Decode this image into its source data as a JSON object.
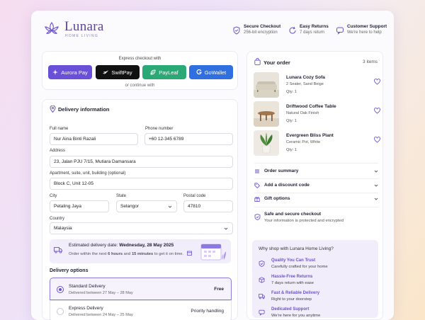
{
  "brand": {
    "name": "Lunara",
    "tagline": "HOME LIVING"
  },
  "header_features": [
    {
      "icon": "shield-icon",
      "title": "Secure Checkout",
      "subtitle": "256-bit encryption"
    },
    {
      "icon": "refresh-icon",
      "title": "Easy Returns",
      "subtitle": "7 days return"
    },
    {
      "icon": "chat-icon",
      "title": "Customer Support",
      "subtitle": "We're here to help"
    }
  ],
  "express": {
    "title": "Express checkout with",
    "methods": [
      {
        "label": "Aurora Pay",
        "color": "#6a4fd8"
      },
      {
        "label": "SwiftPay",
        "color": "#111111"
      },
      {
        "label": "PayLeaf",
        "color": "#2aa876"
      },
      {
        "label": "GoWallet",
        "color": "#2f6fe0"
      }
    ],
    "continue_text": "or continue with"
  },
  "delivery": {
    "title": "Delivery information",
    "full_name": {
      "label": "Full name",
      "value": "Nur Aina Binti Razali"
    },
    "phone": {
      "label": "Phone number",
      "value": "+60 12-345 6789"
    },
    "address": {
      "label": "Address",
      "value": "23, Jalan PJU 7/15, Mutiara Damansara"
    },
    "apartment": {
      "label": "Apartment, suite, unit, building (optional)",
      "value": "Block C, Unit 12-05"
    },
    "city": {
      "label": "City",
      "value": "Petaling Jaya"
    },
    "state": {
      "label": "State",
      "value": "Selangor"
    },
    "postal": {
      "label": "Postal code",
      "value": "47810"
    },
    "country": {
      "label": "Country",
      "value": "Malaysia"
    },
    "estimate": {
      "prefix": "Estimated delivery date: ",
      "date": "Wednesday, 28 May 2025",
      "line_prefix": "Order within the next ",
      "hours": "6 hours",
      "and": " and ",
      "minutes": "15 minutes",
      "line_suffix": " to get it on time."
    }
  },
  "delivery_options": {
    "title": "Delivery options",
    "options": [
      {
        "name": "Standard Delivery",
        "dates": "Delivered between 27 May – 28 May",
        "price": "Free",
        "selected": true
      },
      {
        "name": "Express Delivery",
        "dates": "Delivered between 24 May – 25 May",
        "price": "Priority handling",
        "selected": false
      }
    ]
  },
  "order": {
    "title": "Your order",
    "count": "3 items",
    "items": [
      {
        "name": "Lunara Cozy Sofa",
        "variant": "2 Seater, Sand Beige",
        "qty": "Qty: 1"
      },
      {
        "name": "Driftwood Coffee Table",
        "variant": "Natural Oak Finish",
        "qty": "Qty: 1"
      },
      {
        "name": "Evergreen Bliss Plant",
        "variant": "Ceramic Pot, White",
        "qty": "Qty: 1"
      }
    ],
    "summary_label": "Order summary",
    "discount_label": "Add a discount code",
    "gift_label": "Gift options",
    "safe": {
      "title": "Safe and secure checkout",
      "subtitle": "Your information is protected and encrypted"
    }
  },
  "why": {
    "title": "Why shop with Lunara Home Living?",
    "items": [
      {
        "title": "Quality You Can Trust",
        "desc": "Carefully crafted for your home"
      },
      {
        "title": "Hassle-Free Returns",
        "desc": "7 days return with ease"
      },
      {
        "title": "Fast & Reliable Delivery",
        "desc": "Right to your doorstep"
      },
      {
        "title": "Dedicated Support",
        "desc": "We're here for you anytime"
      }
    ]
  },
  "accent": "#6a55c9"
}
